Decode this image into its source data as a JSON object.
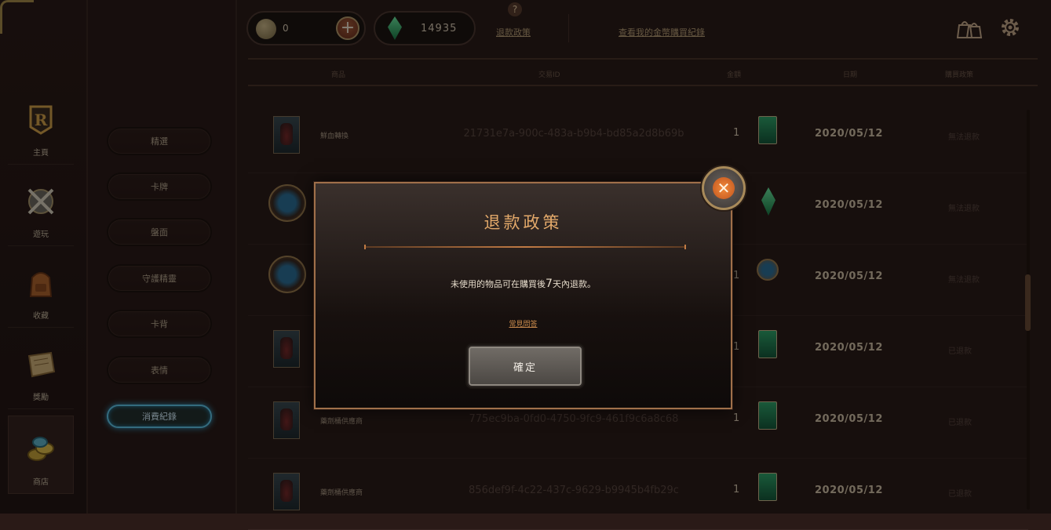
{
  "nav": {
    "items": [
      {
        "label": "主頁",
        "icon": "rune-r-icon"
      },
      {
        "label": "遊玩",
        "icon": "crossed-swords-shield-icon"
      },
      {
        "label": "收藏",
        "icon": "backpack-icon"
      },
      {
        "label": "獎勵",
        "icon": "scroll-map-icon"
      },
      {
        "label": "商店",
        "icon": "coin-pile-icon"
      }
    ]
  },
  "categories": {
    "items": [
      "精選",
      "卡牌",
      "盤面",
      "守護精靈",
      "卡背",
      "表情",
      "消費紀錄"
    ],
    "active": "消費紀錄"
  },
  "currency": {
    "coins": "0",
    "gems": "14935"
  },
  "topbar": {
    "help": "?",
    "refund_policy_link": "退款政策",
    "history_link": "查看我的金幣購買紀錄"
  },
  "table": {
    "headers": [
      "商品",
      "交易ID",
      "金額",
      "日期",
      "購買政策"
    ],
    "rows": [
      {
        "name": "鮮血轉換",
        "txid": "21731e7a-900c-483a-b9b4-bd85a2d8b69b",
        "qty": "1",
        "date": "2020/05/12",
        "status": "無法退款",
        "thumb": "card",
        "pay": "card"
      },
      {
        "name": "",
        "txid": "",
        "qty": "0",
        "date": "2020/05/12",
        "status": "無法退款",
        "thumb": "orb",
        "pay": "gem"
      },
      {
        "name": "",
        "txid": "",
        "qty": "1",
        "date": "2020/05/12",
        "status": "無法退款",
        "thumb": "orb",
        "pay": "orb"
      },
      {
        "name": "",
        "txid": "",
        "qty": "1",
        "date": "2020/05/12",
        "status": "已退款",
        "thumb": "card",
        "pay": "card"
      },
      {
        "name": "藥劑桶供應商",
        "txid": "775ec9ba-0fd0-4750-9fc9-461f9c6a8c68",
        "qty": "1",
        "date": "2020/05/12",
        "status": "已退款",
        "thumb": "card",
        "pay": "card"
      },
      {
        "name": "藥劑桶供應商",
        "txid": "856def9f-4c22-437c-9629-b9945b4fb29c",
        "qty": "1",
        "date": "2020/05/12",
        "status": "已退款",
        "thumb": "card",
        "pay": "card"
      }
    ]
  },
  "modal": {
    "title": "退款政策",
    "body_prefix": "未使用的物品可在購買後",
    "body_days": "7",
    "body_suffix": "天內退款。",
    "faq_link": "常見問答",
    "confirm_label": "確定"
  },
  "colors": {
    "accent_gold": "#a0704a",
    "modal_title": "#e3a96a",
    "active_category": "#5fc3e6"
  }
}
